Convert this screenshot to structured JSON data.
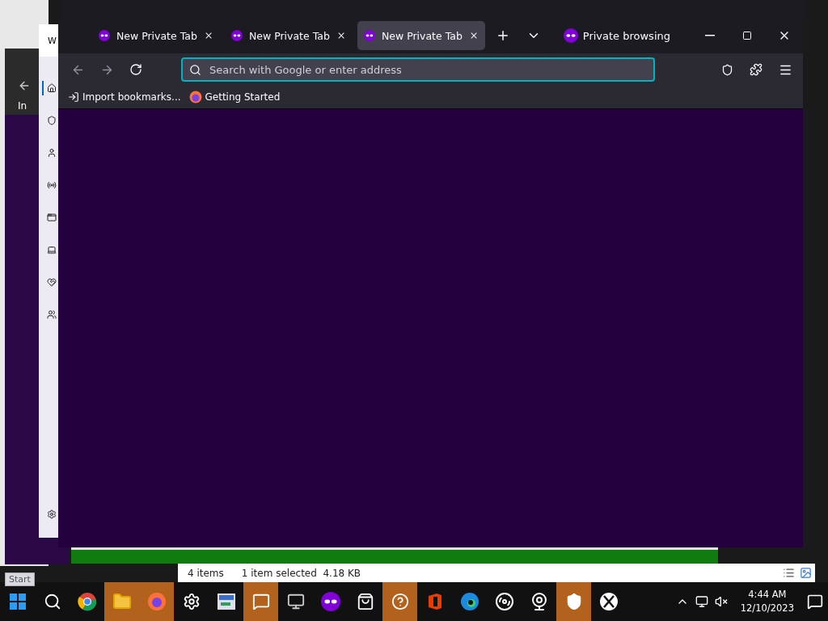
{
  "browser": {
    "tabs": [
      {
        "label": "New Private Tab",
        "selected": false
      },
      {
        "label": "New Private Tab",
        "selected": false
      },
      {
        "label": "New Private Tab",
        "selected": true
      }
    ],
    "private_label": "Private browsing",
    "address": {
      "placeholder": "Search with Google or enter address"
    },
    "bookmarks": [
      {
        "label": "Import bookmarks...",
        "kind": "import"
      },
      {
        "label": "Getting Started",
        "kind": "firefox"
      }
    ]
  },
  "settings_window": {
    "title": "W",
    "nav": [
      {
        "kind": "home",
        "selected": true
      },
      {
        "kind": "shield",
        "selected": false
      },
      {
        "kind": "person",
        "selected": false
      },
      {
        "kind": "wifi",
        "selected": false
      },
      {
        "kind": "window",
        "selected": false
      },
      {
        "kind": "laptop",
        "selected": false
      },
      {
        "kind": "heart",
        "selected": false
      },
      {
        "kind": "people",
        "selected": false
      },
      {
        "kind": "gear",
        "selected": false
      }
    ]
  },
  "back_window": {
    "item": "In"
  },
  "explorer": {
    "status": [
      "4 items",
      "1 item selected  4.18 KB"
    ]
  },
  "tooltip": "Start",
  "taskbar": {
    "apps": [
      {
        "kind": "start",
        "highlighted": false
      },
      {
        "kind": "search",
        "highlighted": false
      },
      {
        "kind": "chrome",
        "highlighted": false
      },
      {
        "kind": "folder",
        "highlighted": true
      },
      {
        "kind": "firefox",
        "highlighted": true
      },
      {
        "kind": "gear",
        "highlighted": false
      },
      {
        "kind": "app",
        "highlighted": false
      },
      {
        "kind": "people",
        "highlighted": true
      },
      {
        "kind": "monitor",
        "highlighted": false
      },
      {
        "kind": "private",
        "highlighted": false
      },
      {
        "kind": "store",
        "highlighted": false
      },
      {
        "kind": "help",
        "highlighted": true
      },
      {
        "kind": "office",
        "highlighted": false
      },
      {
        "kind": "edge",
        "highlighted": false
      },
      {
        "kind": "disc",
        "highlighted": false
      },
      {
        "kind": "webcam",
        "highlighted": false
      },
      {
        "kind": "shield",
        "highlighted": true
      },
      {
        "kind": "xbox",
        "highlighted": false
      }
    ],
    "time": "4:44 AM",
    "date": "12/10/2023"
  }
}
